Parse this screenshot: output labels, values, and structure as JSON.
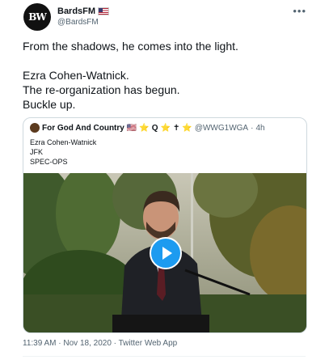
{
  "author": {
    "avatar_text": "BW",
    "name": "BardsFM",
    "handle": "@BardsFM",
    "flag_icon": "us-flag-icon"
  },
  "more_label": "•••",
  "tweet_lines": [
    "From the shadows, he comes into the light.",
    "Ezra Cohen-Watnick.",
    "The re-organization has begun.",
    "Buckle up."
  ],
  "quoted": {
    "name": "For God And Country",
    "handle": "@WWG1WGA",
    "separator": "·",
    "time": "4h",
    "badges": [
      "🇺🇸",
      "⭐",
      "Q",
      "⭐",
      "✝",
      "⭐"
    ],
    "lines": [
      "Ezra Cohen-Watnick",
      "JFK",
      "SPEC-OPS"
    ]
  },
  "meta": "11:39 AM · Nov 18, 2020 · Twitter Web App",
  "colors": {
    "accent": "#1d9bf0",
    "text": "#0f1419",
    "muted": "#536471",
    "border": "#cfd9de"
  }
}
